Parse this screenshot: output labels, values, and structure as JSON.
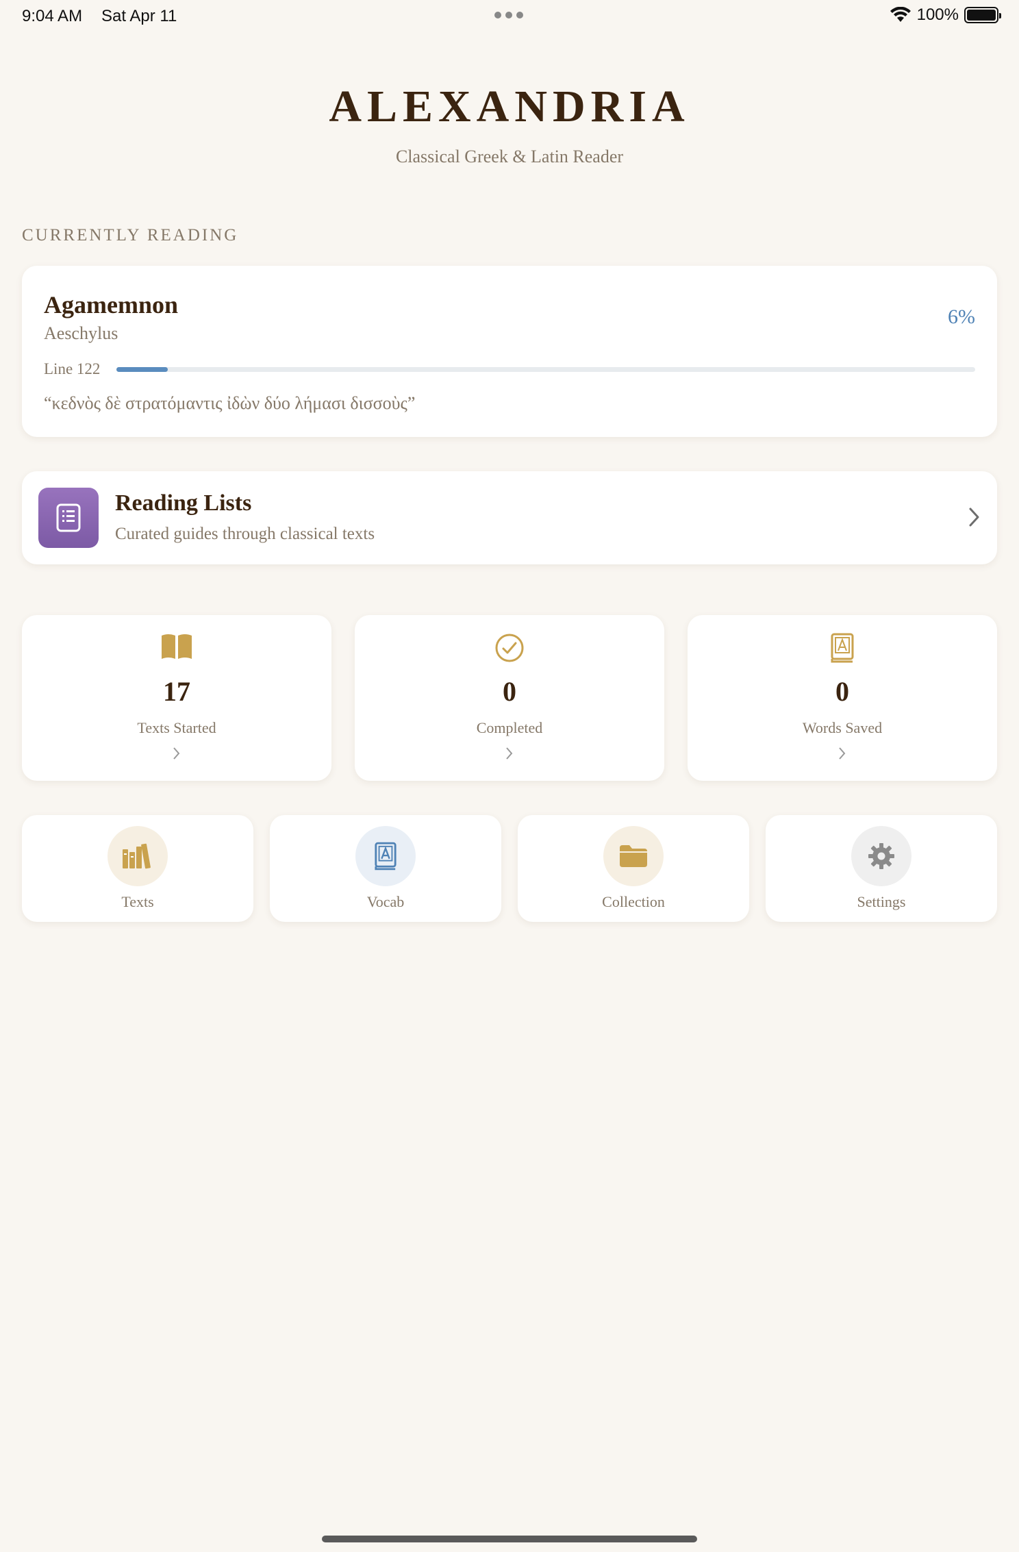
{
  "status_bar": {
    "time": "9:04 AM",
    "date": "Sat Apr 11",
    "battery": "100%",
    "icons": [
      "more-dots-icon",
      "wifi-icon",
      "battery-icon"
    ]
  },
  "header": {
    "title": "ALEXANDRIA",
    "subtitle": "Classical Greek & Latin Reader"
  },
  "currently_reading": {
    "section_label": "CURRENTLY READING",
    "title": "Agamemnon",
    "author": "Aeschylus",
    "progress_label": "6%",
    "progress_fraction": 0.06,
    "line": "Line 122",
    "quote": "“κεδνὸς δὲ στρατόμαντις ἰδὼν δύο λήμασι δισσοὺς”",
    "accent_color": "#4f82b5"
  },
  "reading_lists": {
    "title": "Reading Lists",
    "subtitle": "Curated guides through classical texts",
    "icon": "list-document-icon",
    "icon_color": "#8a66b3"
  },
  "stats": [
    {
      "value": "17",
      "label": "Texts Started",
      "icon": "open-book-icon"
    },
    {
      "value": "0",
      "label": "Completed",
      "icon": "checkmark-circle-icon"
    },
    {
      "value": "0",
      "label": "Words Saved",
      "icon": "vocab-book-icon"
    }
  ],
  "nav": [
    {
      "label": "Texts",
      "icon": "books-shelf-icon"
    },
    {
      "label": "Vocab",
      "icon": "vocab-book-icon"
    },
    {
      "label": "Collection",
      "icon": "folder-icon"
    },
    {
      "label": "Settings",
      "icon": "gear-icon"
    }
  ],
  "colors": {
    "background": "#f9f6f1",
    "gold": "#c9a24e",
    "brown": "#3b2410",
    "muted": "#857868"
  }
}
